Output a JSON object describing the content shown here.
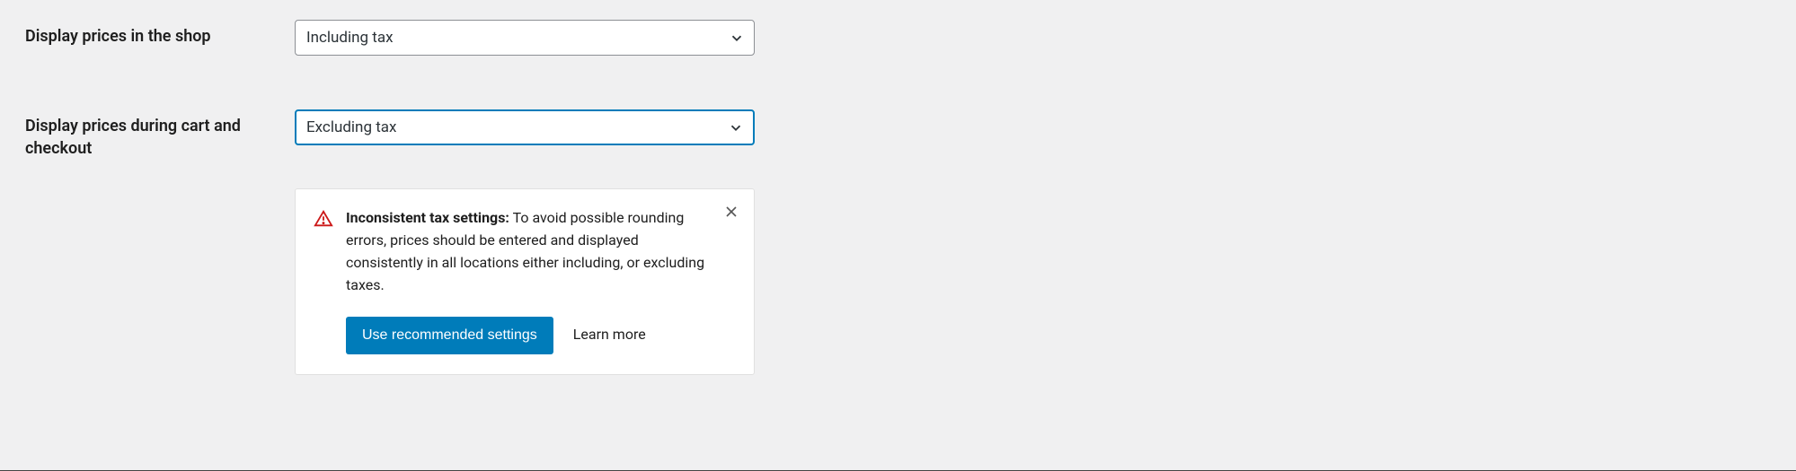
{
  "settings": {
    "shop_prices": {
      "label": "Display prices in the shop",
      "value": "Including tax"
    },
    "cart_prices": {
      "label": "Display prices during cart and checkout",
      "value": "Excluding tax"
    }
  },
  "notice": {
    "title": "Inconsistent tax settings:",
    "body": " To avoid possible rounding errors, prices should be entered and displayed consistently in all locations either including, or excluding taxes.",
    "primary_action": "Use recommended settings",
    "secondary_action": "Learn more"
  }
}
